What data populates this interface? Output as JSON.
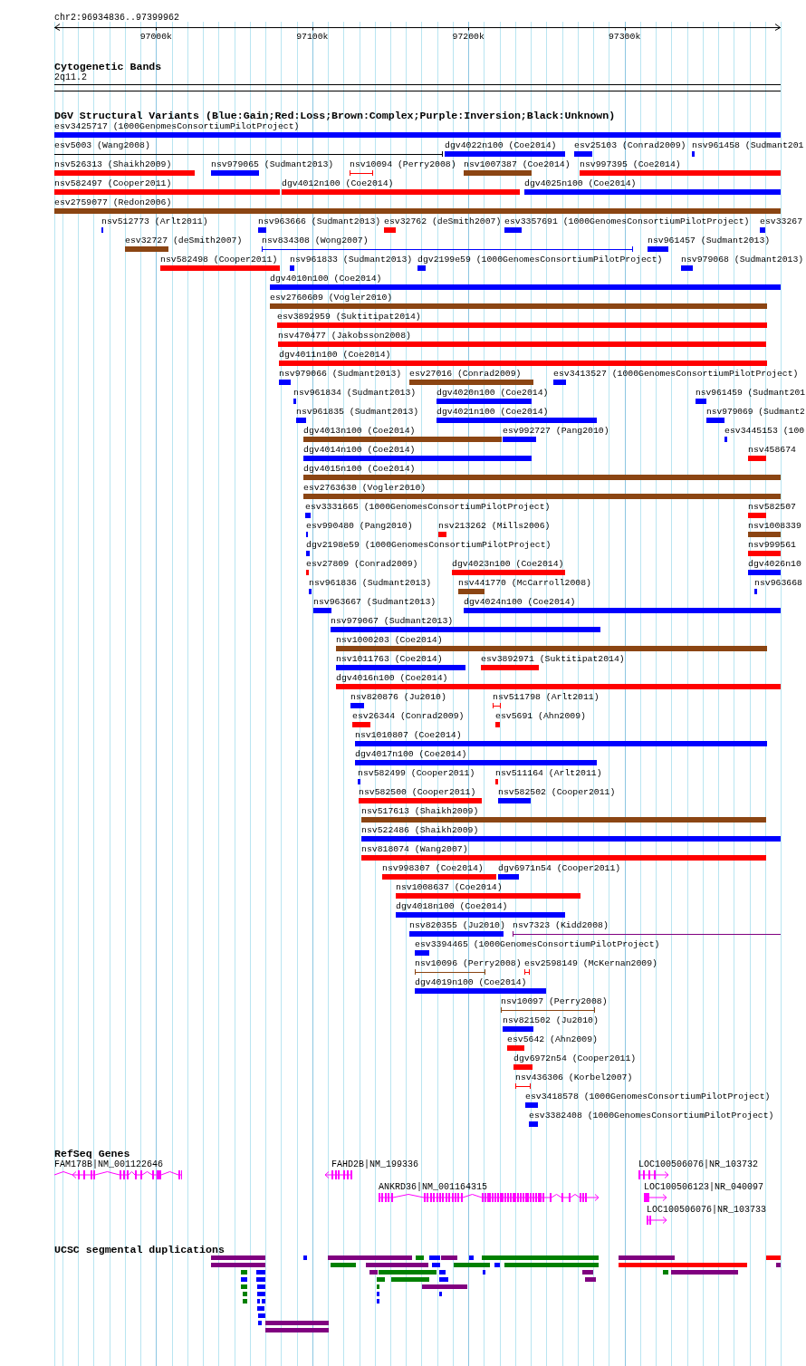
{
  "ruler": {
    "region": "chr2:96934836..97399962",
    "tick_labels": [
      "97000k",
      "97100k",
      "97200k",
      "97300k"
    ]
  },
  "cytogenetic_bands": {
    "title": "Cytogenetic Bands",
    "bands": [
      {
        "label": "2q11.2"
      }
    ]
  },
  "dgv_structural_variants": {
    "title": "DGV Structural Variants (Blue:Gain;Red:Loss;Brown:Complex;Purple:Inversion;Black:Unknown)",
    "variants": [
      {
        "label": "esv3425717 (1000GenomesConsortiumPilotProject)",
        "color": "#0000ff",
        "kind": "bar"
      },
      {
        "label": "esv5003 (Wang2008)",
        "color": "#000000",
        "kind": "span"
      },
      {
        "label": "dgv4022n100 (Coe2014)",
        "color": "#0000ff",
        "kind": "bar"
      },
      {
        "label": "esv25103 (Conrad2009)",
        "color": "#0000ff",
        "kind": "bar"
      },
      {
        "label": "nsv961458 (Sudmant201",
        "color": "#0000ff",
        "kind": "bar"
      },
      {
        "label": "nsv526313 (Shaikh2009)",
        "color": "#ff0000",
        "kind": "bar"
      },
      {
        "label": "nsv979065 (Sudmant2013)",
        "color": "#0000ff",
        "kind": "bar"
      },
      {
        "label": "nsv10094 (Perry2008)",
        "color": "#ff0000",
        "kind": "span"
      },
      {
        "label": "nsv1007387 (Coe2014)",
        "color": "#8b4513",
        "kind": "bar"
      },
      {
        "label": "nsv997395 (Coe2014)",
        "color": "#ff0000",
        "kind": "bar"
      },
      {
        "label": "nsv582497 (Cooper2011)",
        "color": "#ff0000",
        "kind": "bar"
      },
      {
        "label": "dgv4012n100 (Coe2014)",
        "color": "#ff0000",
        "kind": "bar"
      },
      {
        "label": "dgv4025n100 (Coe2014)",
        "color": "#0000ff",
        "kind": "bar"
      },
      {
        "label": "esv2759077 (Redon2006)",
        "color": "#8b4513",
        "kind": "bar"
      },
      {
        "label": "nsv512773 (Arlt2011)",
        "color": "#0000ff",
        "kind": "bar"
      },
      {
        "label": "nsv963666 (Sudmant2013)",
        "color": "#0000ff",
        "kind": "bar"
      },
      {
        "label": "esv32762 (deSmith2007)",
        "color": "#ff0000",
        "kind": "bar"
      },
      {
        "label": "esv3357691 (1000GenomesConsortiumPilotProject)",
        "color": "#0000ff",
        "kind": "bar"
      },
      {
        "label": "esv33267",
        "color": "#0000ff",
        "kind": "bar"
      },
      {
        "label": "esv32727 (deSmith2007)",
        "color": "#8b4513",
        "kind": "bar"
      },
      {
        "label": "nsv834308 (Wong2007)",
        "color": "#0000ff",
        "kind": "span"
      },
      {
        "label": "nsv961457 (Sudmant2013)",
        "color": "#0000ff",
        "kind": "bar"
      },
      {
        "label": "nsv582498 (Cooper2011)",
        "color": "#ff0000",
        "kind": "bar"
      },
      {
        "label": "nsv961833 (Sudmant2013)",
        "color": "#0000ff",
        "kind": "bar"
      },
      {
        "label": "dgv2199e59 (1000GenomesConsortiumPilotProject)",
        "color": "#0000ff",
        "kind": "bar"
      },
      {
        "label": "nsv979068 (Sudmant2013)",
        "color": "#0000ff",
        "kind": "bar"
      },
      {
        "label": "dgv4010n100 (Coe2014)",
        "color": "#0000ff",
        "kind": "bar"
      },
      {
        "label": "esv2760609 (Vogler2010)",
        "color": "#8b4513",
        "kind": "bar"
      },
      {
        "label": "esv3892959 (Suktitipat2014)",
        "color": "#ff0000",
        "kind": "bar"
      },
      {
        "label": "nsv470477 (Jakobsson2008)",
        "color": "#ff0000",
        "kind": "bar"
      },
      {
        "label": "dgv4011n100 (Coe2014)",
        "color": "#ff0000",
        "kind": "bar"
      },
      {
        "label": "nsv979066 (Sudmant2013)",
        "color": "#0000ff",
        "kind": "bar"
      },
      {
        "label": "esv27016 (Conrad2009)",
        "color": "#8b4513",
        "kind": "bar"
      },
      {
        "label": "esv3413527 (1000GenomesConsortiumPilotProject)",
        "color": "#0000ff",
        "kind": "bar"
      },
      {
        "label": "nsv961834 (Sudmant2013)",
        "color": "#0000ff",
        "kind": "bar"
      },
      {
        "label": "dgv4020n100 (Coe2014)",
        "color": "#0000ff",
        "kind": "bar"
      },
      {
        "label": "nsv961459 (Sudmant201",
        "color": "#0000ff",
        "kind": "bar"
      },
      {
        "label": "nsv961835 (Sudmant2013)",
        "color": "#0000ff",
        "kind": "bar"
      },
      {
        "label": "dgv4021n100 (Coe2014)",
        "color": "#0000ff",
        "kind": "bar"
      },
      {
        "label": "nsv979069 (Sudmant2",
        "color": "#0000ff",
        "kind": "bar"
      },
      {
        "label": "dgv4013n100 (Coe2014)",
        "color": "#8b4513",
        "kind": "bar"
      },
      {
        "label": "esv992727 (Pang2010)",
        "color": "#0000ff",
        "kind": "bar"
      },
      {
        "label": "esv3445153 (100",
        "color": "#0000ff",
        "kind": "bar"
      },
      {
        "label": "dgv4014n100 (Coe2014)",
        "color": "#0000ff",
        "kind": "bar"
      },
      {
        "label": "nsv458674",
        "color": "#ff0000",
        "kind": "bar"
      },
      {
        "label": "dgv4015n100 (Coe2014)",
        "color": "#8b4513",
        "kind": "bar"
      },
      {
        "label": "esv2763630 (Vogler2010)",
        "color": "#8b4513",
        "kind": "bar"
      },
      {
        "label": "esv3331665 (1000GenomesConsortiumPilotProject)",
        "color": "#0000ff",
        "kind": "bar"
      },
      {
        "label": "nsv582507",
        "color": "#ff0000",
        "kind": "bar"
      },
      {
        "label": "esv990480 (Pang2010)",
        "color": "#0000ff",
        "kind": "bar"
      },
      {
        "label": "nsv213262 (Mills2006)",
        "color": "#ff0000",
        "kind": "bar"
      },
      {
        "label": "nsv1008339",
        "color": "#8b4513",
        "kind": "bar"
      },
      {
        "label": "dgv2198e59 (1000GenomesConsortiumPilotProject)",
        "color": "#0000ff",
        "kind": "bar"
      },
      {
        "label": "nsv999561",
        "color": "#ff0000",
        "kind": "bar"
      },
      {
        "label": "esv27809 (Conrad2009)",
        "color": "#ff0000",
        "kind": "bar"
      },
      {
        "label": "dgv4023n100 (Coe2014)",
        "color": "#ff0000",
        "kind": "bar"
      },
      {
        "label": "dgv4026n10",
        "color": "#0000ff",
        "kind": "bar"
      },
      {
        "label": "nsv961836 (Sudmant2013)",
        "color": "#0000ff",
        "kind": "bar"
      },
      {
        "label": "nsv441770 (McCarroll2008)",
        "color": "#8b4513",
        "kind": "bar"
      },
      {
        "label": "nsv963668",
        "color": "#0000ff",
        "kind": "bar"
      },
      {
        "label": "nsv963667 (Sudmant2013)",
        "color": "#0000ff",
        "kind": "bar"
      },
      {
        "label": "dgv4024n100 (Coe2014)",
        "color": "#0000ff",
        "kind": "bar"
      },
      {
        "label": "nsv979067 (Sudmant2013)",
        "color": "#0000ff",
        "kind": "bar"
      },
      {
        "label": "nsv1000203 (Coe2014)",
        "color": "#8b4513",
        "kind": "bar"
      },
      {
        "label": "nsv1011763 (Coe2014)",
        "color": "#0000ff",
        "kind": "bar"
      },
      {
        "label": "esv3892971 (Suktitipat2014)",
        "color": "#ff0000",
        "kind": "bar"
      },
      {
        "label": "dgv4016n100 (Coe2014)",
        "color": "#ff0000",
        "kind": "bar"
      },
      {
        "label": "nsv820876 (Ju2010)",
        "color": "#0000ff",
        "kind": "bar"
      },
      {
        "label": "nsv511798 (Arlt2011)",
        "color": "#ff0000",
        "kind": "span"
      },
      {
        "label": "esv26344 (Conrad2009)",
        "color": "#ff0000",
        "kind": "bar"
      },
      {
        "label": "esv5691 (Ahn2009)",
        "color": "#ff0000",
        "kind": "bar"
      },
      {
        "label": "nsv1010807 (Coe2014)",
        "color": "#0000ff",
        "kind": "bar"
      },
      {
        "label": "dgv4017n100 (Coe2014)",
        "color": "#0000ff",
        "kind": "bar"
      },
      {
        "label": "nsv582499 (Cooper2011)",
        "color": "#0000ff",
        "kind": "bar"
      },
      {
        "label": "nsv511164 (Arlt2011)",
        "color": "#ff0000",
        "kind": "bar"
      },
      {
        "label": "nsv582500 (Cooper2011)",
        "color": "#ff0000",
        "kind": "bar"
      },
      {
        "label": "nsv582502 (Cooper2011)",
        "color": "#0000ff",
        "kind": "bar"
      },
      {
        "label": "nsv517613 (Shaikh2009)",
        "color": "#8b4513",
        "kind": "bar"
      },
      {
        "label": "nsv522486 (Shaikh2009)",
        "color": "#0000ff",
        "kind": "bar"
      },
      {
        "label": "nsv818074 (Wang2007)",
        "color": "#ff0000",
        "kind": "bar"
      },
      {
        "label": "nsv998307 (Coe2014)",
        "color": "#ff0000",
        "kind": "bar"
      },
      {
        "label": "dgv6971n54 (Cooper2011)",
        "color": "#0000ff",
        "kind": "bar"
      },
      {
        "label": "nsv1008637 (Coe2014)",
        "color": "#ff0000",
        "kind": "bar"
      },
      {
        "label": "dgv4018n100 (Coe2014)",
        "color": "#0000ff",
        "kind": "bar"
      },
      {
        "label": "nsv820355 (Ju2010)",
        "color": "#0000ff",
        "kind": "bar"
      },
      {
        "label": "nsv7323 (Kidd2008)",
        "color": "#800080",
        "kind": "span"
      },
      {
        "label": "esv3394465 (1000GenomesConsortiumPilotProject)",
        "color": "#0000ff",
        "kind": "bar"
      },
      {
        "label": "nsv10096 (Perry2008)",
        "color": "#8b4513",
        "kind": "span"
      },
      {
        "label": "esv2598149 (McKernan2009)",
        "color": "#ff0000",
        "kind": "span"
      },
      {
        "label": "dgv4019n100 (Coe2014)",
        "color": "#0000ff",
        "kind": "bar"
      },
      {
        "label": "nsv10097 (Perry2008)",
        "color": "#8b4513",
        "kind": "span"
      },
      {
        "label": "nsv821502 (Ju2010)",
        "color": "#0000ff",
        "kind": "bar"
      },
      {
        "label": "esv5642 (Ahn2009)",
        "color": "#ff0000",
        "kind": "bar"
      },
      {
        "label": "dgv6972n54 (Cooper2011)",
        "color": "#ff0000",
        "kind": "bar"
      },
      {
        "label": "nsv436306 (Korbel2007)",
        "color": "#ff0000",
        "kind": "span"
      },
      {
        "label": "esv3418578 (1000GenomesConsortiumPilotProject)",
        "color": "#0000ff",
        "kind": "bar"
      },
      {
        "label": "esv3382408 (1000GenomesConsortiumPilotProject)",
        "color": "#0000ff",
        "kind": "bar"
      }
    ]
  },
  "refseq_genes": {
    "title": "RefSeq Genes",
    "genes": [
      {
        "label": "FAM178B|NM_001122646",
        "kind": "reverse"
      },
      {
        "label": "FAHD2B|NM_199336",
        "kind": "reverse"
      },
      {
        "label": "LOC100506076|NR_103732",
        "kind": "forward"
      },
      {
        "label": "ANKRD36|NM_001164315",
        "kind": "forward"
      },
      {
        "label": "LOC100506123|NR_040097",
        "kind": "forward"
      },
      {
        "label": "LOC100506076|NR_103733",
        "kind": "forward"
      }
    ]
  },
  "segmental_duplications": {
    "title": "UCSC segmental duplications",
    "blocks": [
      {
        "color": "#800080"
      },
      {
        "color": "#0000ff"
      },
      {
        "color": "#800080"
      },
      {
        "color": "#008000"
      },
      {
        "color": "#0000ff"
      },
      {
        "color": "#800080"
      },
      {
        "color": "#0000ff"
      },
      {
        "color": "#008000"
      },
      {
        "color": "#800080"
      },
      {
        "color": "#ff0000"
      },
      {
        "color": "#800080"
      },
      {
        "color": "#008000"
      },
      {
        "color": "#800080"
      },
      {
        "color": "#0000ff"
      },
      {
        "color": "#008000"
      },
      {
        "color": "#0000ff"
      },
      {
        "color": "#008000"
      },
      {
        "color": "#ff0000"
      },
      {
        "color": "#800080"
      },
      {
        "color": "#008000"
      },
      {
        "color": "#0000ff"
      },
      {
        "color": "#800080"
      },
      {
        "color": "#008000"
      },
      {
        "color": "#0000ff"
      },
      {
        "color": "#0000ff"
      },
      {
        "color": "#800080"
      },
      {
        "color": "#008000"
      },
      {
        "color": "#800080"
      },
      {
        "color": "#0000ff"
      },
      {
        "color": "#0000ff"
      },
      {
        "color": "#008000"
      },
      {
        "color": "#008000"
      },
      {
        "color": "#0000ff"
      },
      {
        "color": "#800080"
      },
      {
        "color": "#008000"
      },
      {
        "color": "#0000ff"
      },
      {
        "color": "#008000"
      },
      {
        "color": "#800080"
      },
      {
        "color": "#008000"
      },
      {
        "color": "#0000ff"
      },
      {
        "color": "#0000ff"
      },
      {
        "color": "#0000ff"
      },
      {
        "color": "#008000"
      },
      {
        "color": "#0000ff"
      },
      {
        "color": "#0000ff"
      },
      {
        "color": "#0000ff"
      },
      {
        "color": "#0000ff"
      },
      {
        "color": "#0000ff"
      },
      {
        "color": "#0000ff"
      },
      {
        "color": "#800080"
      },
      {
        "color": "#800080"
      }
    ]
  }
}
